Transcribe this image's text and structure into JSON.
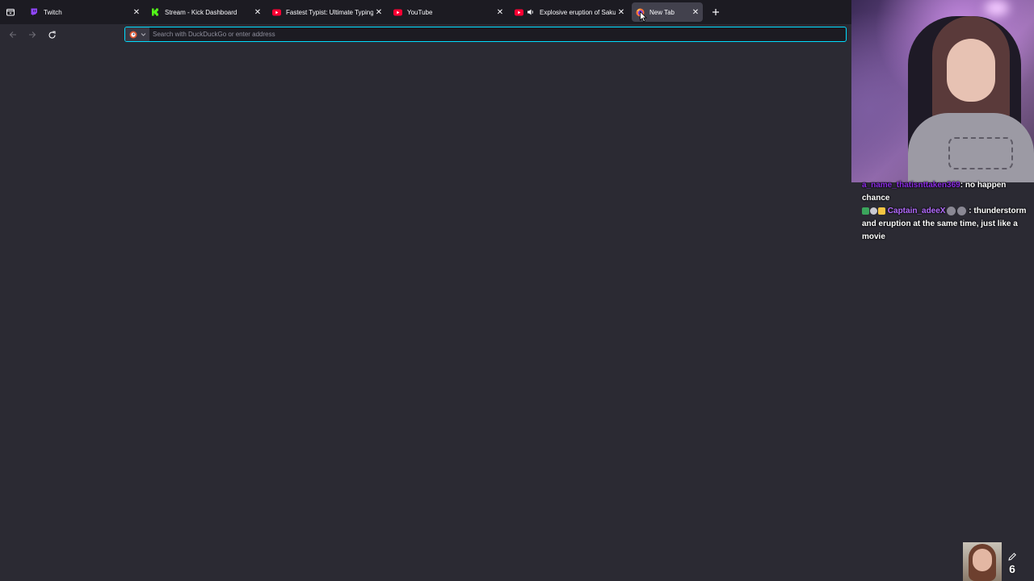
{
  "browser": {
    "tabs": [
      {
        "title": "Twitch",
        "favicon": "twitch-icon",
        "color": "#9146ff"
      },
      {
        "title": "Stream - Kick Dashboard",
        "favicon": "kick-icon",
        "color": "#53fc18"
      },
      {
        "title": "Fastest Typist: Ultimate Typing C",
        "favicon": "youtube-icon",
        "color": "#ff0033"
      },
      {
        "title": "YouTube",
        "favicon": "youtube-icon",
        "color": "#ff0033"
      },
      {
        "title": "Explosive eruption of Sakura",
        "favicon": "youtube-icon",
        "color": "#ff0033",
        "playing_audio": true
      },
      {
        "title": "New Tab",
        "favicon": "firefox-icon",
        "active": true
      }
    ],
    "urlbar": {
      "placeholder": "Search with DuckDuckGo or enter address"
    },
    "accent": "#00ddff"
  },
  "stream_overlay": {
    "chat": [
      {
        "user": "a_name_thatisnttaken369",
        "text": ": no happen chance"
      },
      {
        "user": "Captain_adeeX",
        "text": ": thunderstorm and eruption at the same time, just like a movie"
      }
    ],
    "widget_counter": "6"
  }
}
